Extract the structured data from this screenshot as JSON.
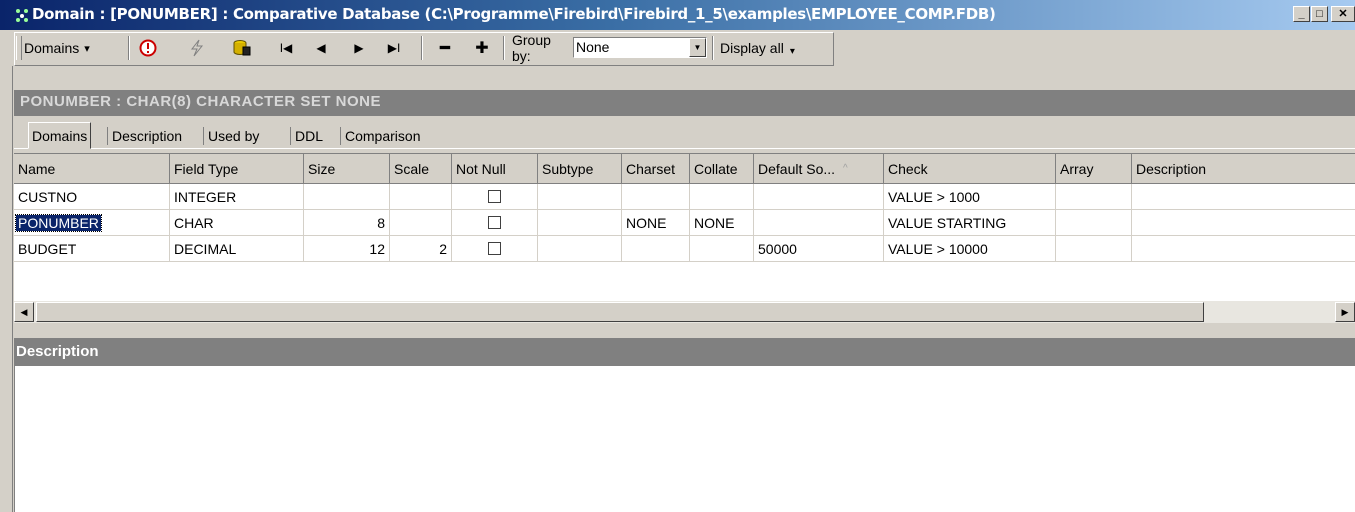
{
  "window": {
    "title": "Domain : [PONUMBER] : Comparative Database (C:\\Programme\\Firebird\\Firebird_1_5\\examples\\EMPLOYEE_COMP.FDB)",
    "minimize": "_",
    "maximize": "□",
    "close": "✕"
  },
  "toolbar": {
    "domains_label": "Domains",
    "dropdown_arrow": "▾",
    "first": "I◀",
    "prev": "◀",
    "next": "▶",
    "last": "▶I",
    "minus": "━",
    "plus": "✚",
    "group_by_label": "Group by:",
    "group_by_value": "None",
    "display_all_label": "Display all",
    "icons": [
      "alert-icon",
      "lightning-icon",
      "database-icon"
    ],
    "accent_red": "#cc0000"
  },
  "header": {
    "text": "PONUMBER : CHAR(8) CHARACTER SET NONE"
  },
  "tabs": [
    {
      "label": "Domains",
      "active": true
    },
    {
      "label": "Description",
      "active": false
    },
    {
      "label": "Used by",
      "active": false
    },
    {
      "label": "DDL",
      "active": false
    },
    {
      "label": "Comparison",
      "active": false
    }
  ],
  "grid": {
    "columns": [
      "Name",
      "Field Type",
      "Size",
      "Scale",
      "Not Null",
      "Subtype",
      "Charset",
      "Collate",
      "Default So...",
      "Check",
      "Array",
      "Description"
    ],
    "sort_indicator": "^",
    "rows": [
      {
        "name": "CUSTNO",
        "field_type": "INTEGER",
        "size": "",
        "scale": "",
        "not_null": false,
        "subtype": "",
        "charset": "",
        "collate": "",
        "default_source": "",
        "check": "VALUE > 1000",
        "array": "",
        "description": "",
        "selected": false
      },
      {
        "name": "PONUMBER",
        "field_type": "CHAR",
        "size": "8",
        "scale": "",
        "not_null": false,
        "subtype": "",
        "charset": "NONE",
        "collate": "NONE",
        "default_source": "",
        "check": "VALUE STARTING",
        "array": "",
        "description": "",
        "selected": true
      },
      {
        "name": "BUDGET",
        "field_type": "DECIMAL",
        "size": "12",
        "scale": "2",
        "not_null": false,
        "subtype": "",
        "charset": "",
        "collate": "",
        "default_source": "50000",
        "check": "VALUE > 10000",
        "array": "",
        "description": "",
        "selected": false
      }
    ]
  },
  "scrollbar": {
    "left_arrow": "◀",
    "right_arrow": "▶"
  },
  "description_panel": {
    "title": "Description",
    "content": ""
  }
}
